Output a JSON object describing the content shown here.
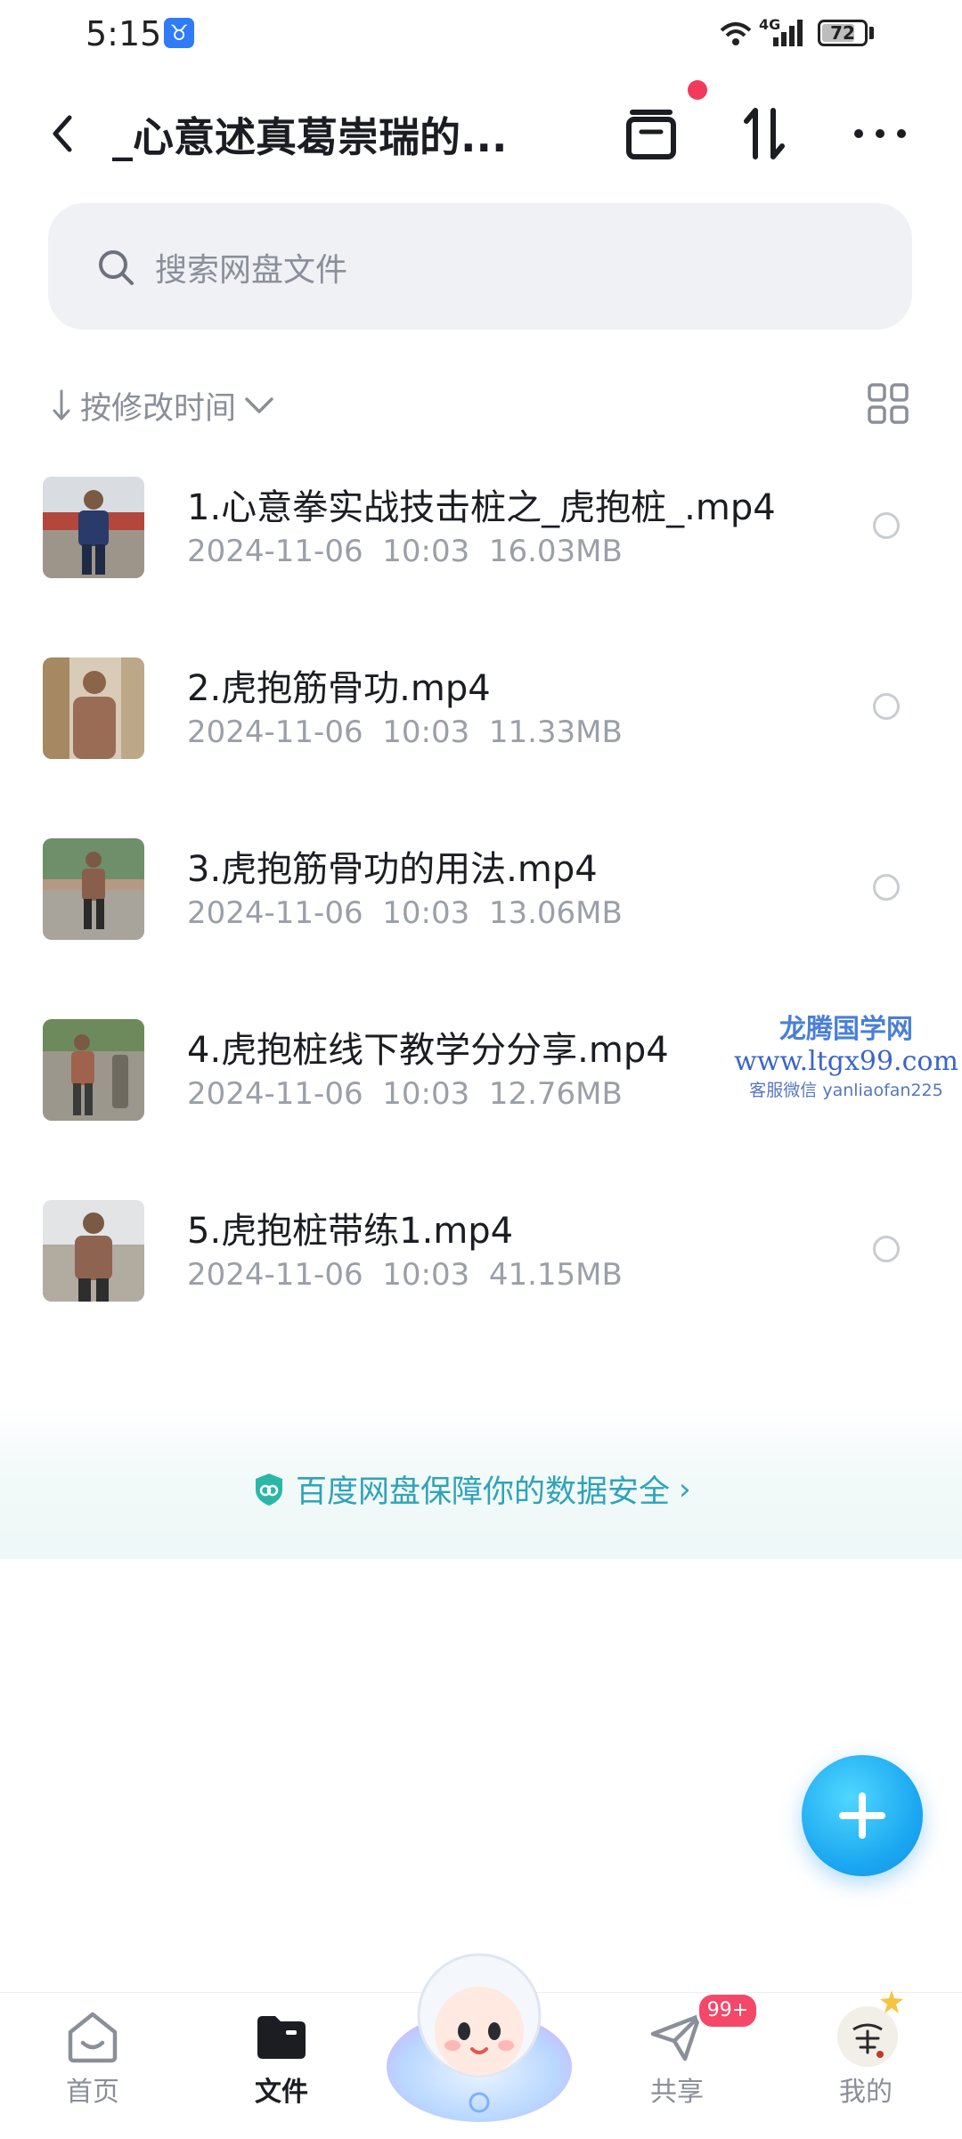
{
  "status_bar": {
    "time": "5:15",
    "network": "4G",
    "battery": "72"
  },
  "header": {
    "title": "_心意述真葛崇瑞的..."
  },
  "search": {
    "placeholder": "搜索网盘文件"
  },
  "sort": {
    "label": "按修改时间"
  },
  "files": [
    {
      "name": "1.心意拳实战技击桩之_虎抱桩_.mp4",
      "date": "2024-11-06",
      "time": "10:03",
      "size": "16.03MB"
    },
    {
      "name": "2.虎抱筋骨功.mp4",
      "date": "2024-11-06",
      "time": "10:03",
      "size": "11.33MB"
    },
    {
      "name": "3.虎抱筋骨功的用法.mp4",
      "date": "2024-11-06",
      "time": "10:03",
      "size": "13.06MB"
    },
    {
      "name": "4.虎抱桩线下教学分分享.mp4",
      "date": "2024-11-06",
      "time": "10:03",
      "size": "12.76MB"
    },
    {
      "name": "5.虎抱桩带练1.mp4",
      "date": "2024-11-06",
      "time": "10:03",
      "size": "41.15MB"
    }
  ],
  "watermark": {
    "line1": "龙腾国学网",
    "line2": "www.ltgx99.com",
    "line3": "客服微信 yanliaofan225"
  },
  "security_banner": {
    "text": "百度网盘保障你的数据安全"
  },
  "bottom_nav": {
    "home": "首页",
    "files": "文件",
    "share": "共享",
    "share_badge": "99+",
    "me": "我的"
  },
  "colors": {
    "accent": "#1aa6f0",
    "badge": "#f5476a",
    "security": "#2fa3b8"
  }
}
